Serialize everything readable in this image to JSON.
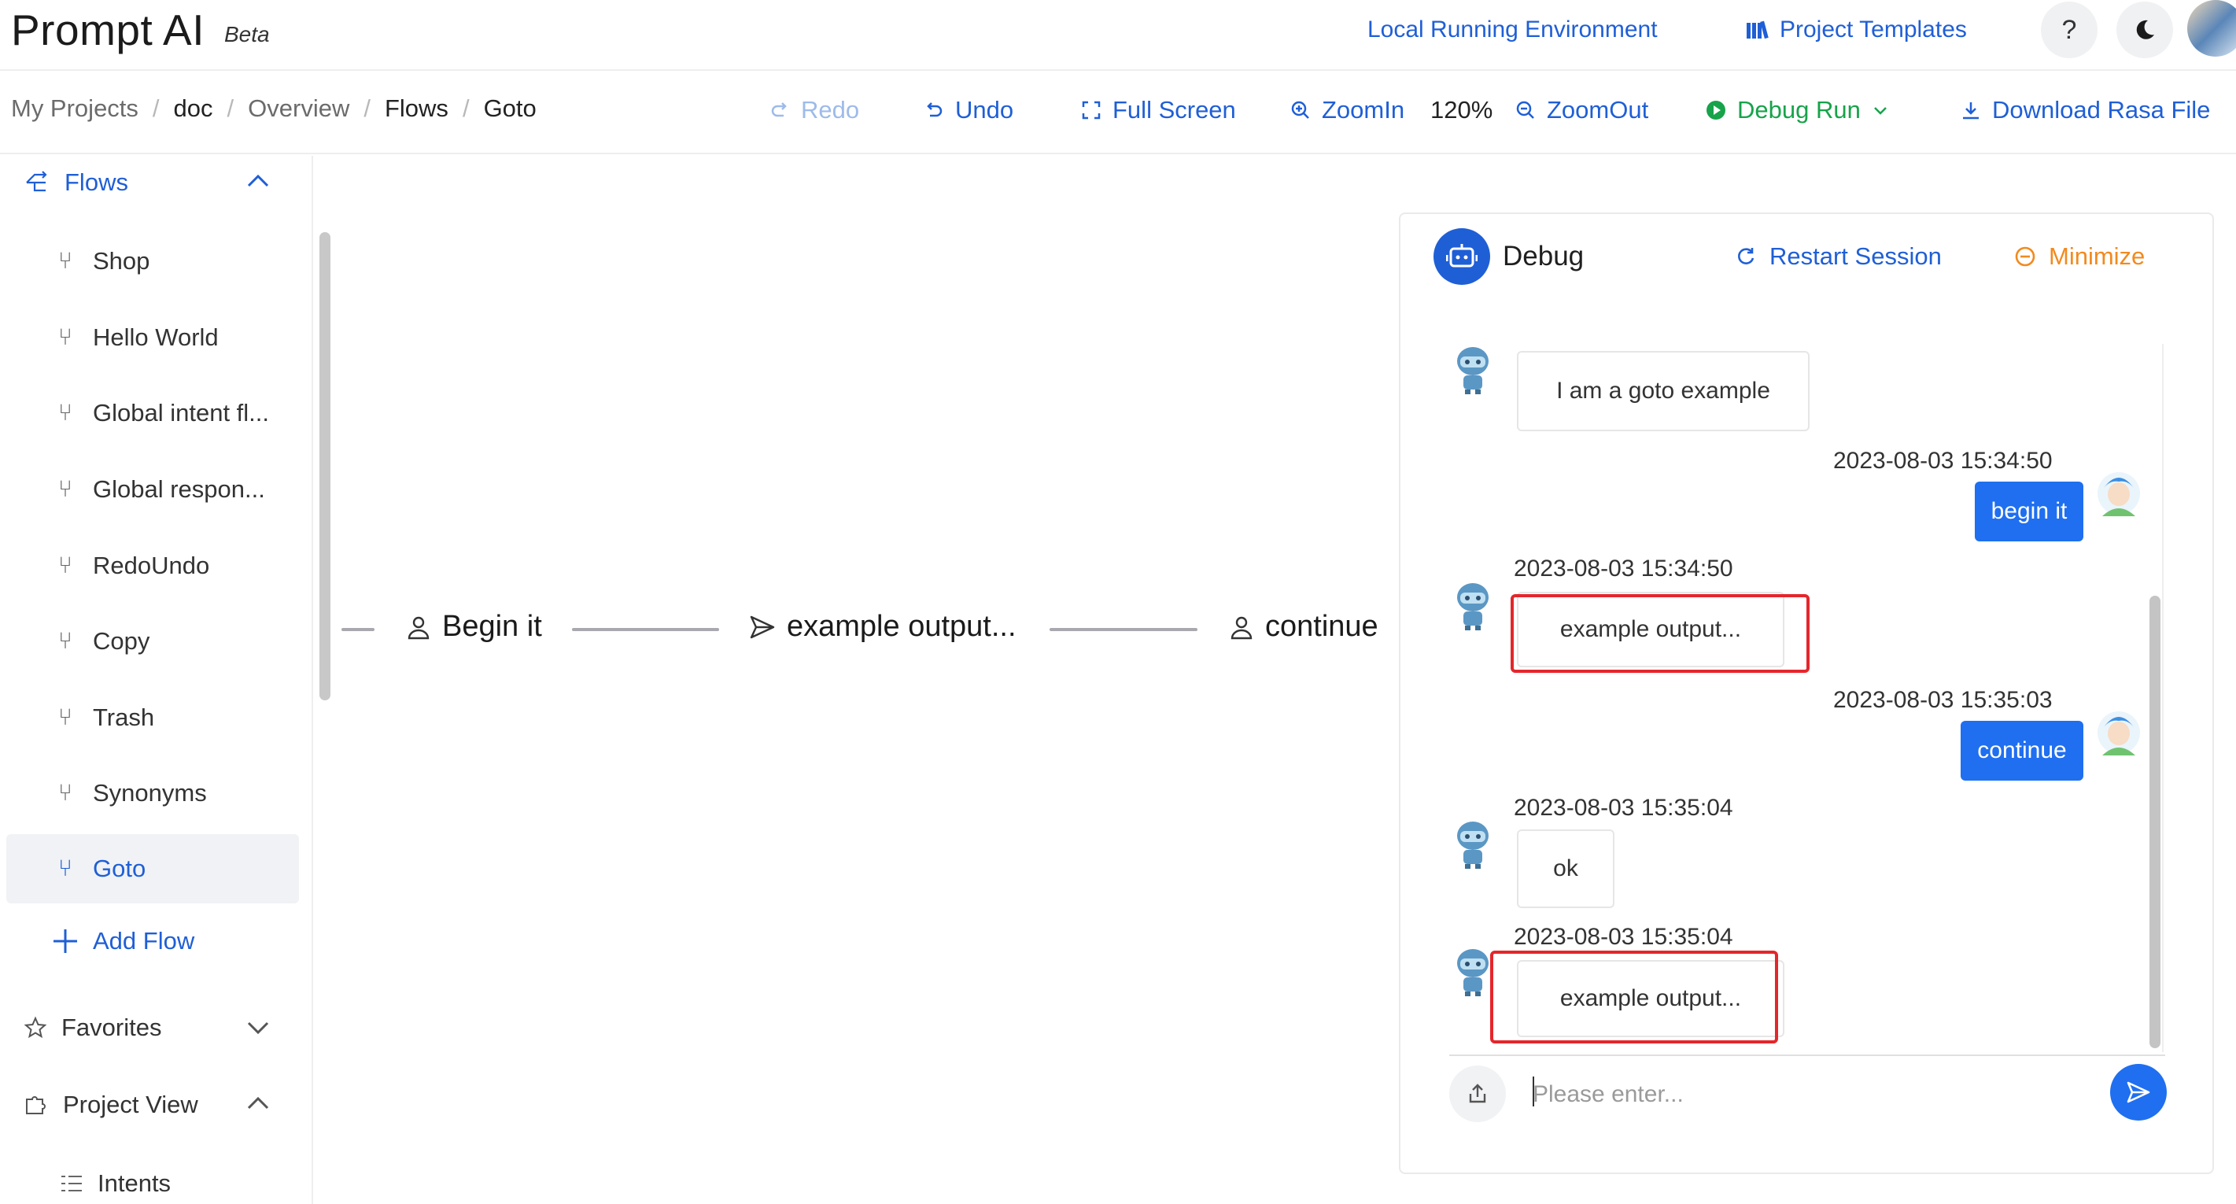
{
  "app": {
    "title": "Prompt AI",
    "badge": "Beta"
  },
  "header": {
    "local_env": "Local Running Environment",
    "templates": "Project Templates",
    "help": "?",
    "theme_icon": "moon-icon"
  },
  "breadcrumb": [
    "My Projects",
    "doc",
    "Overview",
    "Flows",
    "Goto"
  ],
  "toolbar": {
    "redo": "Redo",
    "undo": "Undo",
    "fullscreen": "Full Screen",
    "zoomin": "ZoomIn",
    "zoom_level": "120%",
    "zoomout": "ZoomOut",
    "debug_run": "Debug Run",
    "download": "Download Rasa File"
  },
  "sidebar": {
    "flows_label": "Flows",
    "items": [
      "Shop",
      "Hello World",
      "Global intent fl...",
      "Global respon...",
      "RedoUndo",
      "Copy",
      "Trash",
      "Synonyms",
      "Goto"
    ],
    "active_item": "Goto",
    "add_flow": "Add Flow",
    "favorites": "Favorites",
    "project_view": "Project View",
    "intents": "Intents"
  },
  "canvas": {
    "nodes": [
      "Begin it",
      "example output...",
      "continue"
    ]
  },
  "debug": {
    "title": "Debug",
    "restart": "Restart Session",
    "minimize": "Minimize",
    "messages": [
      {
        "from": "bot",
        "text": "I am a goto example",
        "time": ""
      },
      {
        "from": "user",
        "text": "begin it",
        "time": "2023-08-03 15:34:50"
      },
      {
        "from": "bot",
        "text": "example output...",
        "time": "2023-08-03 15:34:50"
      },
      {
        "from": "user",
        "text": "continue",
        "time": "2023-08-03 15:35:03"
      },
      {
        "from": "bot",
        "text": "ok",
        "time": "2023-08-03 15:35:04"
      },
      {
        "from": "bot",
        "text": "example output...",
        "time": "2023-08-03 15:35:04"
      }
    ],
    "input_placeholder": "Please enter..."
  },
  "colors": {
    "accent": "#1f5fd6",
    "user_bubble": "#1f6ff0",
    "debug_green": "#17a34a",
    "minimize_orange": "#f28a1e",
    "highlight_red": "#e5262b"
  }
}
